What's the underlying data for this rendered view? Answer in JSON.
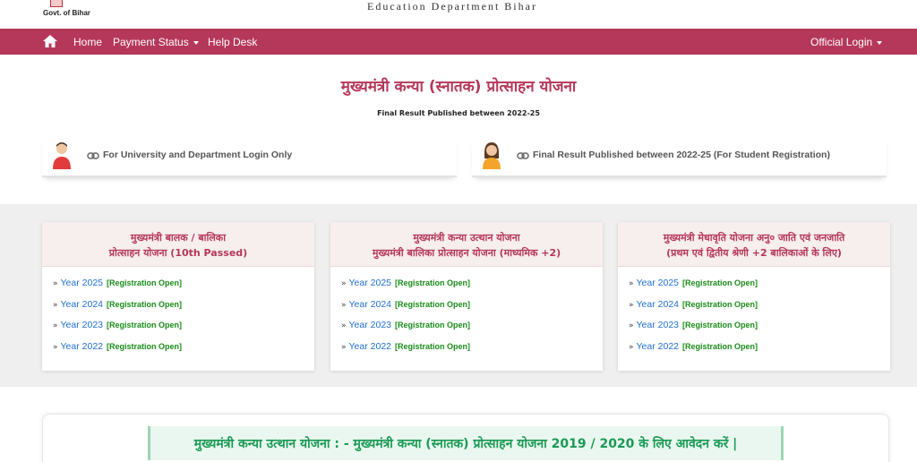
{
  "header": {
    "govt_label": "Govt. of Bihar",
    "dept_title": "Education Department Bihar"
  },
  "nav": {
    "home": "Home",
    "payment_status": "Payment Status",
    "help_desk": "Help Desk",
    "official_login": "Official Login",
    "bg_color": "#b5375a"
  },
  "main": {
    "title": "मुख्यमंत्री कन्या (स्नातक) प्रोत्साहन योजना",
    "subtitle": "Final Result Published between 2022-25"
  },
  "login_cards": [
    {
      "icon": "male-user-icon",
      "label": "For University and Department Login Only"
    },
    {
      "icon": "female-user-icon",
      "label": "Final Result Published between 2022-25 (For Student Registration)"
    }
  ],
  "schemes": [
    {
      "title_line1": "मुख्यमंत्री बालक / बालिका",
      "title_line2": "प्रोत्साहन योजना (10th Passed)",
      "items": [
        {
          "year": "Year 2025",
          "status": "[Registration Open]"
        },
        {
          "year": "Year 2024",
          "status": "[Registration Open]"
        },
        {
          "year": "Year 2023",
          "status": "[Registration Open]"
        },
        {
          "year": "Year 2022",
          "status": "[Registration Open]"
        }
      ]
    },
    {
      "title_line1": "मुख्यमंत्री कन्या उत्थान योजना",
      "title_line2": "मुख्यमंत्री बालिका प्रोत्साहन योजना (माध्यमिक +2)",
      "items": [
        {
          "year": "Year 2025",
          "status": "[Registration Open]"
        },
        {
          "year": "Year 2024",
          "status": "[Registration Open]"
        },
        {
          "year": "Year 2023",
          "status": "[Registration Open]"
        },
        {
          "year": "Year 2022",
          "status": "[Registration Open]"
        }
      ]
    },
    {
      "title_line1": "मुख्यमंत्री मेधावृति योजना अनु० जाति एवं जनजाति",
      "title_line2": "(प्रथम एवं द्वितीय श्रेणी +2 बालिकाओं के लिए)",
      "items": [
        {
          "year": "Year 2025",
          "status": "[Registration Open]"
        },
        {
          "year": "Year 2024",
          "status": "[Registration Open]"
        },
        {
          "year": "Year 2023",
          "status": "[Registration Open]"
        },
        {
          "year": "Year 2022",
          "status": "[Registration Open]"
        }
      ]
    }
  ],
  "bottom_banner": "मुख्यमंत्री कन्या उत्थान योजना : - मुख्यमंत्री कन्या (स्नातक) प्रोत्साहन योजना 2019 / 2020 के लिए आवेदन करें |",
  "colors": {
    "accent": "#b5375a",
    "link_blue": "#1f6fd1",
    "status_green": "#1a8c1a",
    "banner_green": "#1a9a55"
  }
}
